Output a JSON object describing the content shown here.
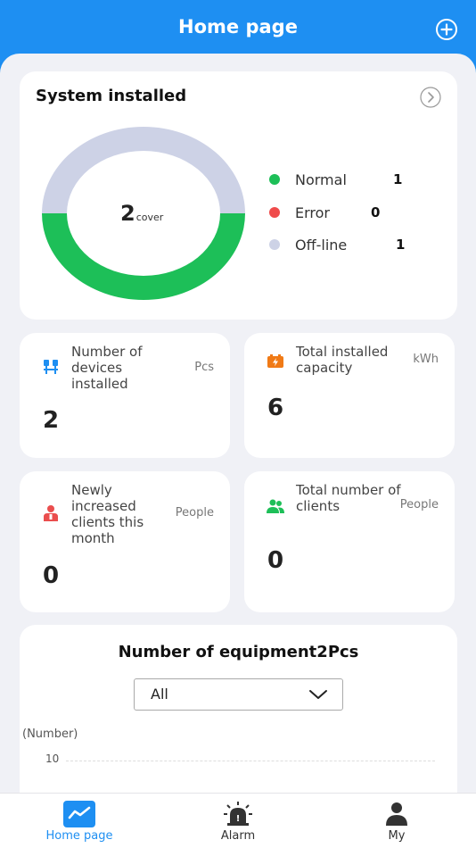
{
  "header": {
    "title": "Home page",
    "add_icon": "plus-circle-icon"
  },
  "system": {
    "title": "System installed",
    "count": "2",
    "unit": "cover",
    "legend": [
      {
        "label": "Normal",
        "value": "1",
        "color": "#1dbf58"
      },
      {
        "label": "Error",
        "value": "0",
        "color": "#ef4b4b"
      },
      {
        "label": "Off-line",
        "value": "1",
        "color": "#cdd2e6"
      }
    ]
  },
  "stats": [
    {
      "label": "Number of devices installed",
      "unit": "Pcs",
      "value": "2",
      "icon": "devices-icon",
      "color": "#1e8ff2"
    },
    {
      "label": "Total installed capacity",
      "unit": "kWh",
      "value": "6",
      "icon": "battery-charge-icon",
      "color": "#f07a16"
    },
    {
      "label": "Newly increased clients this month",
      "unit": "People",
      "value": "0",
      "icon": "new-client-icon",
      "color": "#ea4e4e"
    },
    {
      "label": "Total number of clients",
      "unit": "People",
      "value": "0",
      "icon": "clients-icon",
      "color": "#1dbf58"
    }
  ],
  "equipment": {
    "title": "Number of equipment2Pcs",
    "select_value": "All",
    "axis_label": "(Number)",
    "tick": "10"
  },
  "tabs": [
    {
      "label": "Home page",
      "icon": "chart-icon",
      "active": true
    },
    {
      "label": "Alarm",
      "icon": "alarm-icon",
      "active": false
    },
    {
      "label": "My",
      "icon": "user-icon",
      "active": false
    }
  ],
  "colors": {
    "primary": "#1e8ff2",
    "background": "#f0f1f6"
  }
}
